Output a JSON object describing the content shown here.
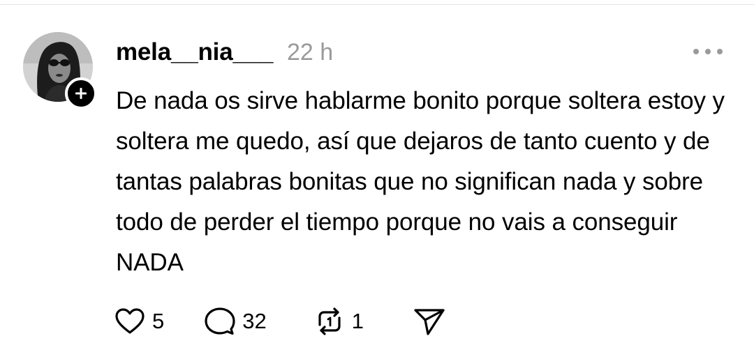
{
  "post": {
    "author": {
      "username": "mela__nia___",
      "avatar_icon": "profile-photo",
      "follow_icon": "plus-icon"
    },
    "timestamp": "22 h",
    "more_icon": "more-horizontal-icon",
    "text": "De nada os sirve hablarme bonito porque soltera estoy y soltera me quedo, así que dejaros de tanto cuento y de tantas palabras bonitas que no significan nada y sobre todo de perder el tiempo porque no vais a conseguir NADA",
    "actions": {
      "like": {
        "icon": "heart-icon",
        "count": "5"
      },
      "reply": {
        "icon": "comment-icon",
        "count": "32"
      },
      "repost": {
        "icon": "repost-icon",
        "count": "1"
      },
      "share": {
        "icon": "send-icon"
      }
    }
  },
  "colors": {
    "text": "#000000",
    "muted": "#9a9a9a",
    "background": "#ffffff",
    "divider": "#e4e4e4"
  }
}
